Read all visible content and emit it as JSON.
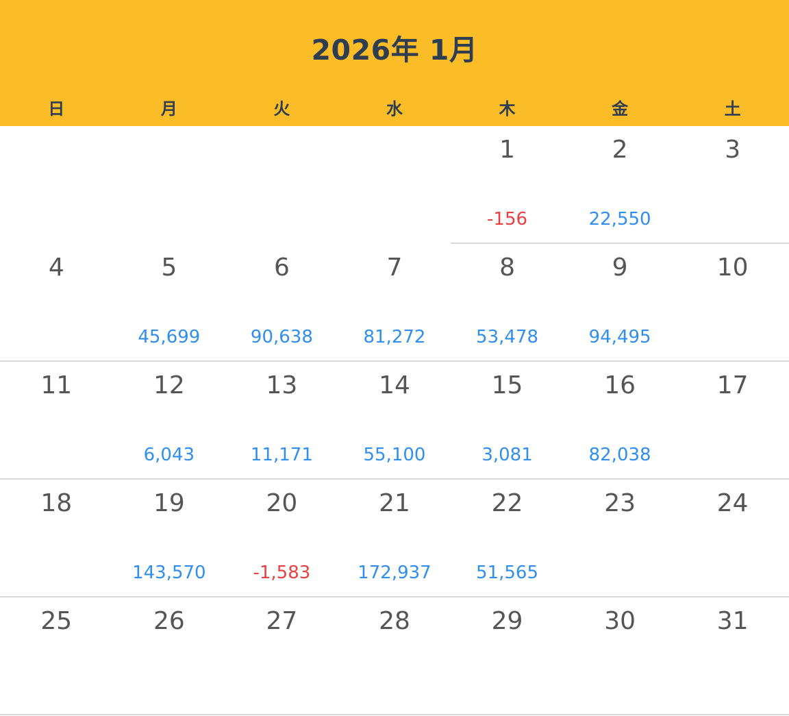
{
  "header": {
    "title": "2026年 1月",
    "background_color": "#fbbd27"
  },
  "weekdays": [
    "日",
    "月",
    "火",
    "水",
    "木",
    "金",
    "土"
  ],
  "colors": {
    "positive_amount": "#2f8ef0",
    "negative_amount": "#ec4040",
    "day_number": "#555555"
  },
  "weeks": [
    {
      "days": [
        {
          "day": "",
          "amount": ""
        },
        {
          "day": "",
          "amount": ""
        },
        {
          "day": "",
          "amount": ""
        },
        {
          "day": "",
          "amount": ""
        },
        {
          "day": "1",
          "amount": "-156"
        },
        {
          "day": "2",
          "amount": "22,550"
        },
        {
          "day": "3",
          "amount": ""
        }
      ]
    },
    {
      "days": [
        {
          "day": "4",
          "amount": ""
        },
        {
          "day": "5",
          "amount": "45,699"
        },
        {
          "day": "6",
          "amount": "90,638"
        },
        {
          "day": "7",
          "amount": "81,272"
        },
        {
          "day": "8",
          "amount": "53,478"
        },
        {
          "day": "9",
          "amount": "94,495"
        },
        {
          "day": "10",
          "amount": ""
        }
      ]
    },
    {
      "days": [
        {
          "day": "11",
          "amount": ""
        },
        {
          "day": "12",
          "amount": "6,043"
        },
        {
          "day": "13",
          "amount": "11,171"
        },
        {
          "day": "14",
          "amount": "55,100"
        },
        {
          "day": "15",
          "amount": "3,081"
        },
        {
          "day": "16",
          "amount": "82,038"
        },
        {
          "day": "17",
          "amount": ""
        }
      ]
    },
    {
      "days": [
        {
          "day": "18",
          "amount": ""
        },
        {
          "day": "19",
          "amount": "143,570"
        },
        {
          "day": "20",
          "amount": "-1,583"
        },
        {
          "day": "21",
          "amount": "172,937"
        },
        {
          "day": "22",
          "amount": "51,565"
        },
        {
          "day": "23",
          "amount": ""
        },
        {
          "day": "24",
          "amount": ""
        }
      ]
    },
    {
      "days": [
        {
          "day": "25",
          "amount": ""
        },
        {
          "day": "26",
          "amount": ""
        },
        {
          "day": "27",
          "amount": ""
        },
        {
          "day": "28",
          "amount": ""
        },
        {
          "day": "29",
          "amount": ""
        },
        {
          "day": "30",
          "amount": ""
        },
        {
          "day": "31",
          "amount": ""
        }
      ]
    }
  ]
}
